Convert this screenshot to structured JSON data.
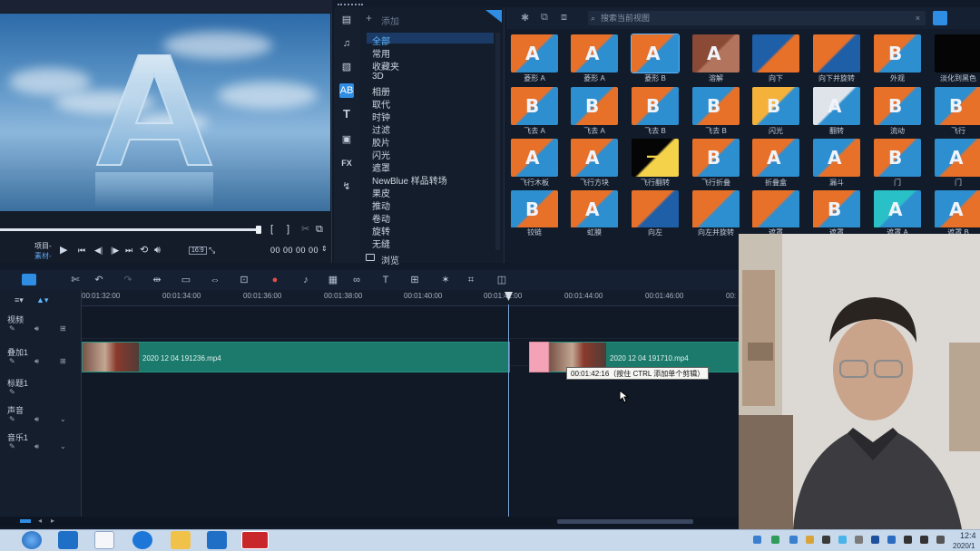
{
  "preview": {
    "mode_project": "项目-",
    "mode_clip": "素材-",
    "aspect": "16:9",
    "timecode": "00 00 00 00"
  },
  "library": {
    "add_label": "添加",
    "categories": [
      "全部",
      "常用",
      "收藏夹",
      "3D",
      "相册",
      "取代",
      "时钟",
      "过滤",
      "胶片",
      "闪光",
      "遮罩",
      "NewBlue 样品转场",
      "果皮",
      "推动",
      "卷动",
      "旋转",
      "无缝"
    ],
    "browse_label": "浏览",
    "search_placeholder": "搜索当前视图",
    "thumbnails": [
      {
        "label": "菱形 A"
      },
      {
        "label": "菱形 A"
      },
      {
        "label": "菱形 B"
      },
      {
        "label": "溶解"
      },
      {
        "label": "向下"
      },
      {
        "label": "向下并旋转"
      },
      {
        "label": "外观"
      },
      {
        "label": "淡化到黑色"
      },
      {
        "label": "飞去 A"
      },
      {
        "label": "飞去 A"
      },
      {
        "label": "飞去 B"
      },
      {
        "label": "飞去 B"
      },
      {
        "label": "闪光"
      },
      {
        "label": "翻转"
      },
      {
        "label": "流动"
      },
      {
        "label": "飞行"
      },
      {
        "label": "飞行木板"
      },
      {
        "label": "飞行方块"
      },
      {
        "label": "飞行翻转"
      },
      {
        "label": "飞行折叠"
      },
      {
        "label": "折叠盒"
      },
      {
        "label": "漏斗"
      },
      {
        "label": "门"
      },
      {
        "label": "门"
      },
      {
        "label": "铰链"
      },
      {
        "label": "虹膜"
      },
      {
        "label": "向左"
      },
      {
        "label": "向左并旋转"
      },
      {
        "label": "遮罩"
      },
      {
        "label": "遮罩"
      },
      {
        "label": "遮罩 A"
      },
      {
        "label": "遮罩 B"
      }
    ]
  },
  "timeline": {
    "ruler": [
      "00:01:32:00",
      "00:01:34:00",
      "00:01:36:00",
      "00:01:38:00",
      "00:01:40:00",
      "00:01:42:00",
      "00:01:44:00",
      "00:01:46:00",
      "00:"
    ],
    "tracks": [
      {
        "label": "视频"
      },
      {
        "label": "叠加1"
      },
      {
        "label": "标题1"
      },
      {
        "label": "声音"
      },
      {
        "label": "音乐1"
      }
    ],
    "clip1": "2020 12 04 191236.mp4",
    "clip2": "2020 12 04 191710.mp4",
    "tooltip": "00:01:42:16（按住 CTRL 添加单个剪辑）"
  },
  "taskbar": {
    "time": "12:4",
    "date": "2020/1"
  },
  "colors": {
    "accent": "#2f8de4",
    "clip": "#1b7a6c",
    "thumb_orange": "#e8712a",
    "thumb_blue": "#2d8ed0"
  }
}
